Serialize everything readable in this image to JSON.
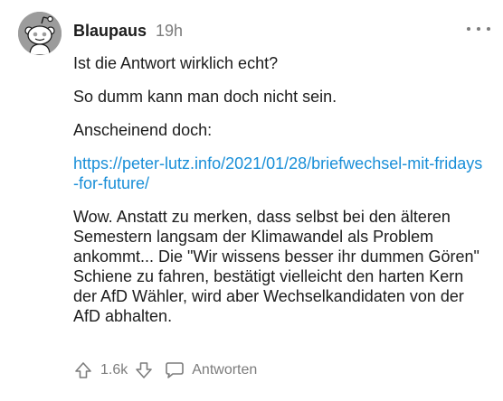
{
  "comment": {
    "author": "Blaupaus",
    "timestamp": "19h",
    "paragraphs": [
      "Ist die Antwort wirklich echt?",
      "So dumm kann man doch nicht sein.",
      "Anscheinend doch:"
    ],
    "link": "https://peter-lutz.info/2021/01/28/briefwechsel-mit-fridays-for-future/",
    "closing_paragraph": "Wow. Anstatt zu merken, dass selbst bei den älteren Semestern langsam der Klimawandel als Problem ankommt... Die \"Wir wissens besser ihr dummen Gören\" Schiene zu fahren, bestätigt vielleicht den harten Kern der AfD Wähler, wird aber Wechselkandidaten von der AfD abhalten."
  },
  "actions": {
    "vote_count": "1.6k",
    "reply_label": "Antworten"
  },
  "icons": {
    "avatar": "reddit-snoo-avatar",
    "more": "more-options-icon",
    "upvote": "upvote-arrow-icon",
    "downvote": "downvote-arrow-icon",
    "reply": "speech-bubble-icon"
  },
  "colors": {
    "link": "#1a8fd8",
    "muted": "#7c7c7c",
    "text": "#1c1c1c",
    "avatar_bg": "#9c9c9c"
  }
}
